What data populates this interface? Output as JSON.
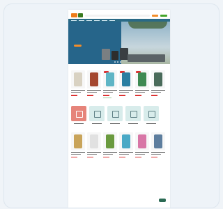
{
  "colors": {
    "frame_bg": "#eef3f8",
    "brand_orange": "#ee7b1a",
    "brand_green": "#3a7a1f",
    "nav_bg": "#2a6a86",
    "hero_bg": "#26658a",
    "sale_red": "#d33"
  },
  "header": {
    "top_notice": "",
    "logo_text": "",
    "icons": [
      "search-icon",
      "account-icon",
      "cart-icon"
    ]
  },
  "hero": {
    "title": "",
    "cta_label": ""
  },
  "sections": [
    {
      "title": "",
      "products": 6
    },
    {
      "title": "",
      "subtitle": "",
      "categories": 6
    },
    {
      "title": "",
      "products": 6
    },
    {
      "title": ""
    }
  ]
}
